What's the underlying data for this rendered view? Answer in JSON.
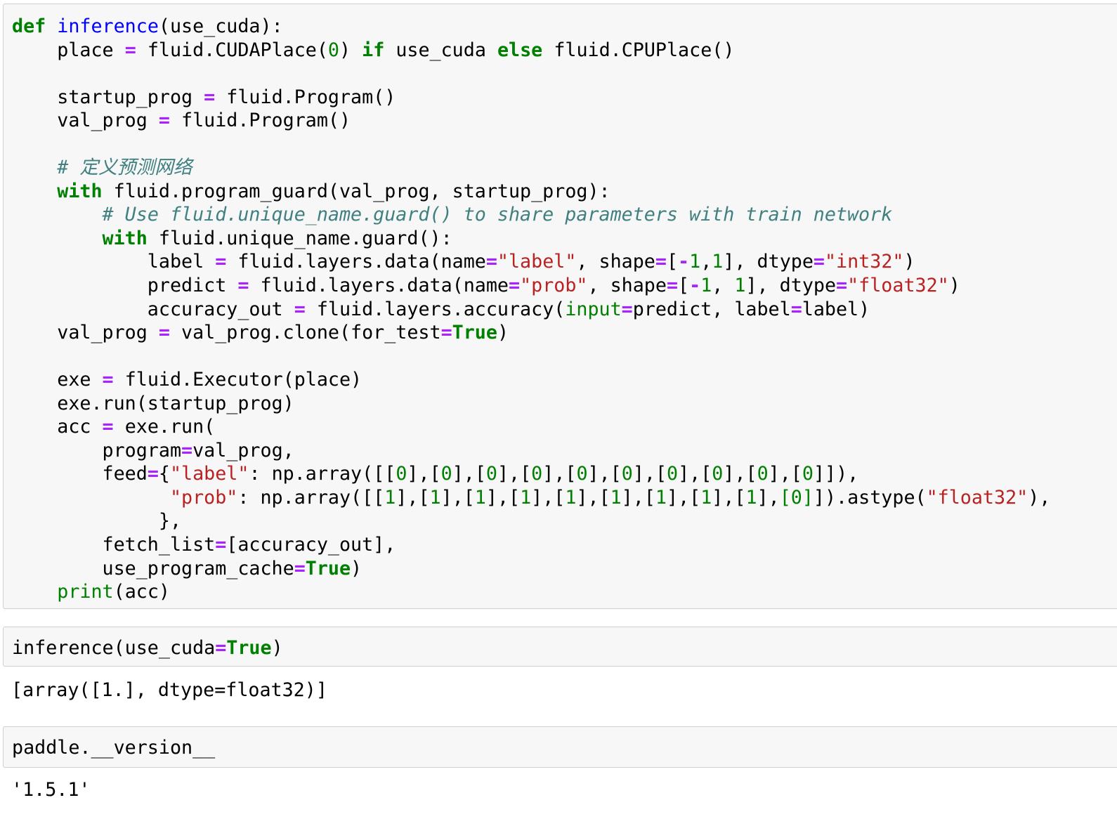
{
  "cells": [
    {
      "kind": "code",
      "lines": [
        [
          [
            "k",
            "def"
          ],
          [
            "t",
            " "
          ],
          [
            "nf",
            "inference"
          ],
          [
            "t",
            "(use_cuda):"
          ]
        ],
        [
          [
            "t",
            "    place "
          ],
          [
            "o",
            "="
          ],
          [
            "t",
            " fluid.CUDAPlace("
          ],
          [
            "m",
            "0"
          ],
          [
            "t",
            ") "
          ],
          [
            "k",
            "if"
          ],
          [
            "t",
            " use_cuda "
          ],
          [
            "k",
            "else"
          ],
          [
            "t",
            " fluid.CPUPlace()"
          ]
        ],
        [],
        [
          [
            "t",
            "    startup_prog "
          ],
          [
            "o",
            "="
          ],
          [
            "t",
            " fluid.Program()"
          ]
        ],
        [
          [
            "t",
            "    val_prog "
          ],
          [
            "o",
            "="
          ],
          [
            "t",
            " fluid.Program()"
          ]
        ],
        [],
        [
          [
            "c",
            "    # 定义预测网络"
          ]
        ],
        [
          [
            "t",
            "    "
          ],
          [
            "k",
            "with"
          ],
          [
            "t",
            " fluid.program_guard(val_prog, startup_prog):"
          ]
        ],
        [
          [
            "t",
            "        "
          ],
          [
            "c",
            "# Use fluid.unique_name.guard() to share parameters with train network"
          ]
        ],
        [
          [
            "t",
            "        "
          ],
          [
            "k",
            "with"
          ],
          [
            "t",
            " fluid.unique_name.guard():"
          ]
        ],
        [
          [
            "t",
            "            label "
          ],
          [
            "o",
            "="
          ],
          [
            "t",
            " fluid.layers.data(name"
          ],
          [
            "o",
            "="
          ],
          [
            "s",
            "\"label\""
          ],
          [
            "t",
            ", shape"
          ],
          [
            "o",
            "="
          ],
          [
            "t",
            "["
          ],
          [
            "o",
            "-"
          ],
          [
            "m",
            "1"
          ],
          [
            "t",
            ","
          ],
          [
            "m",
            "1"
          ],
          [
            "t",
            "], dtype"
          ],
          [
            "o",
            "="
          ],
          [
            "s",
            "\"int32\""
          ],
          [
            "t",
            ")"
          ]
        ],
        [
          [
            "t",
            "            predict "
          ],
          [
            "o",
            "="
          ],
          [
            "t",
            " fluid.layers.data(name"
          ],
          [
            "o",
            "="
          ],
          [
            "s",
            "\"prob\""
          ],
          [
            "t",
            ", shape"
          ],
          [
            "o",
            "="
          ],
          [
            "t",
            "["
          ],
          [
            "o",
            "-"
          ],
          [
            "m",
            "1"
          ],
          [
            "t",
            ", "
          ],
          [
            "m",
            "1"
          ],
          [
            "t",
            "], dtype"
          ],
          [
            "o",
            "="
          ],
          [
            "s",
            "\"float32\""
          ],
          [
            "t",
            ")"
          ]
        ],
        [
          [
            "t",
            "            accuracy_out "
          ],
          [
            "o",
            "="
          ],
          [
            "t",
            " fluid.layers.accuracy("
          ],
          [
            "nb",
            "input"
          ],
          [
            "o",
            "="
          ],
          [
            "t",
            "predict, label"
          ],
          [
            "o",
            "="
          ],
          [
            "t",
            "label)"
          ]
        ],
        [
          [
            "t",
            "    val_prog "
          ],
          [
            "o",
            "="
          ],
          [
            "t",
            " val_prog.clone(for_test"
          ],
          [
            "o",
            "="
          ],
          [
            "k",
            "True"
          ],
          [
            "t",
            ")"
          ]
        ],
        [],
        [
          [
            "t",
            "    exe "
          ],
          [
            "o",
            "="
          ],
          [
            "t",
            " fluid.Executor(place)"
          ]
        ],
        [
          [
            "t",
            "    exe.run(startup_prog)"
          ]
        ],
        [
          [
            "t",
            "    acc "
          ],
          [
            "o",
            "="
          ],
          [
            "t",
            " exe.run("
          ]
        ],
        [
          [
            "t",
            "        program"
          ],
          [
            "o",
            "="
          ],
          [
            "t",
            "val_prog,"
          ]
        ],
        [
          [
            "t",
            "        feed"
          ],
          [
            "o",
            "="
          ],
          [
            "t",
            "{"
          ],
          [
            "s",
            "\"label\""
          ],
          [
            "t",
            ": np.array([["
          ],
          [
            "m",
            "0"
          ],
          [
            "t",
            "],["
          ],
          [
            "m",
            "0"
          ],
          [
            "t",
            "],["
          ],
          [
            "m",
            "0"
          ],
          [
            "t",
            "],["
          ],
          [
            "m",
            "0"
          ],
          [
            "t",
            "],["
          ],
          [
            "m",
            "0"
          ],
          [
            "t",
            "],["
          ],
          [
            "m",
            "0"
          ],
          [
            "t",
            "],["
          ],
          [
            "m",
            "0"
          ],
          [
            "t",
            "],["
          ],
          [
            "m",
            "0"
          ],
          [
            "t",
            "],["
          ],
          [
            "m",
            "0"
          ],
          [
            "t",
            "],["
          ],
          [
            "m",
            "0"
          ],
          [
            "t",
            "]]),"
          ]
        ],
        [
          [
            "t",
            "              "
          ],
          [
            "s",
            "\"prob\""
          ],
          [
            "t",
            ": np.array([["
          ],
          [
            "m",
            "1"
          ],
          [
            "t",
            "],["
          ],
          [
            "m",
            "1"
          ],
          [
            "t",
            "],["
          ],
          [
            "m",
            "1"
          ],
          [
            "t",
            "],["
          ],
          [
            "m",
            "1"
          ],
          [
            "t",
            "],["
          ],
          [
            "m",
            "1"
          ],
          [
            "t",
            "],["
          ],
          [
            "m",
            "1"
          ],
          [
            "t",
            "],["
          ],
          [
            "m",
            "1"
          ],
          [
            "t",
            "],["
          ],
          [
            "m",
            "1"
          ],
          [
            "t",
            "],["
          ],
          [
            "m",
            "1"
          ],
          [
            "t",
            "],"
          ],
          [
            "m",
            "[0]"
          ],
          [
            "t",
            "]).astype("
          ],
          [
            "s",
            "\"float32\""
          ],
          [
            "t",
            "),"
          ]
        ],
        [
          [
            "t",
            "             },"
          ]
        ],
        [
          [
            "t",
            "        fetch_list"
          ],
          [
            "o",
            "="
          ],
          [
            "t",
            "[accuracy_out],"
          ]
        ],
        [
          [
            "t",
            "        use_program_cache"
          ],
          [
            "o",
            "="
          ],
          [
            "k",
            "True"
          ],
          [
            "t",
            ")"
          ]
        ],
        [
          [
            "t",
            "    "
          ],
          [
            "nb",
            "print"
          ],
          [
            "t",
            "(acc)"
          ]
        ]
      ]
    },
    {
      "kind": "code",
      "lines": [
        [
          [
            "t",
            "inference(use_cuda"
          ],
          [
            "o",
            "="
          ],
          [
            "k",
            "True"
          ],
          [
            "t",
            ")"
          ]
        ]
      ],
      "output": "[array([1.], dtype=float32)]"
    },
    {
      "kind": "code",
      "lines": [
        [
          [
            "t",
            "paddle.__version__"
          ]
        ]
      ],
      "output": "'1.5.1'"
    }
  ],
  "colors": {
    "keyword": "#008000",
    "function_name": "#0000ff",
    "operator": "#aa22ff",
    "number": "#008000",
    "string": "#ba2121",
    "comment": "#408080",
    "cell_background": "#f7f7f7",
    "cell_border": "#cfcfcf"
  }
}
